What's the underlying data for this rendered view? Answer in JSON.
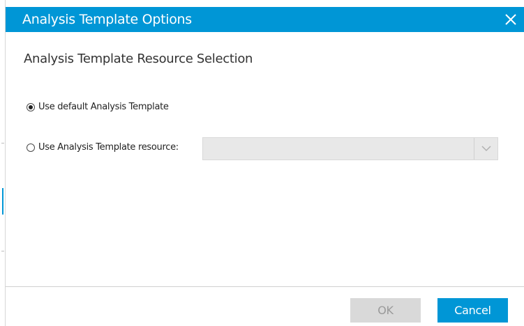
{
  "dialog": {
    "title": "Analysis Template Options",
    "close_icon": "close-icon",
    "accent_color": "#0096d6"
  },
  "section": {
    "title": "Analysis Template Resource Selection"
  },
  "options": {
    "default_label": "Use default Analysis Template",
    "default_selected": true,
    "resource_label": "Use Analysis Template resource:",
    "resource_selected": false,
    "resource_value": "",
    "dropdown_icon": "chevron-down-icon"
  },
  "buttons": {
    "ok_label": "OK",
    "ok_enabled": false,
    "cancel_label": "Cancel"
  }
}
